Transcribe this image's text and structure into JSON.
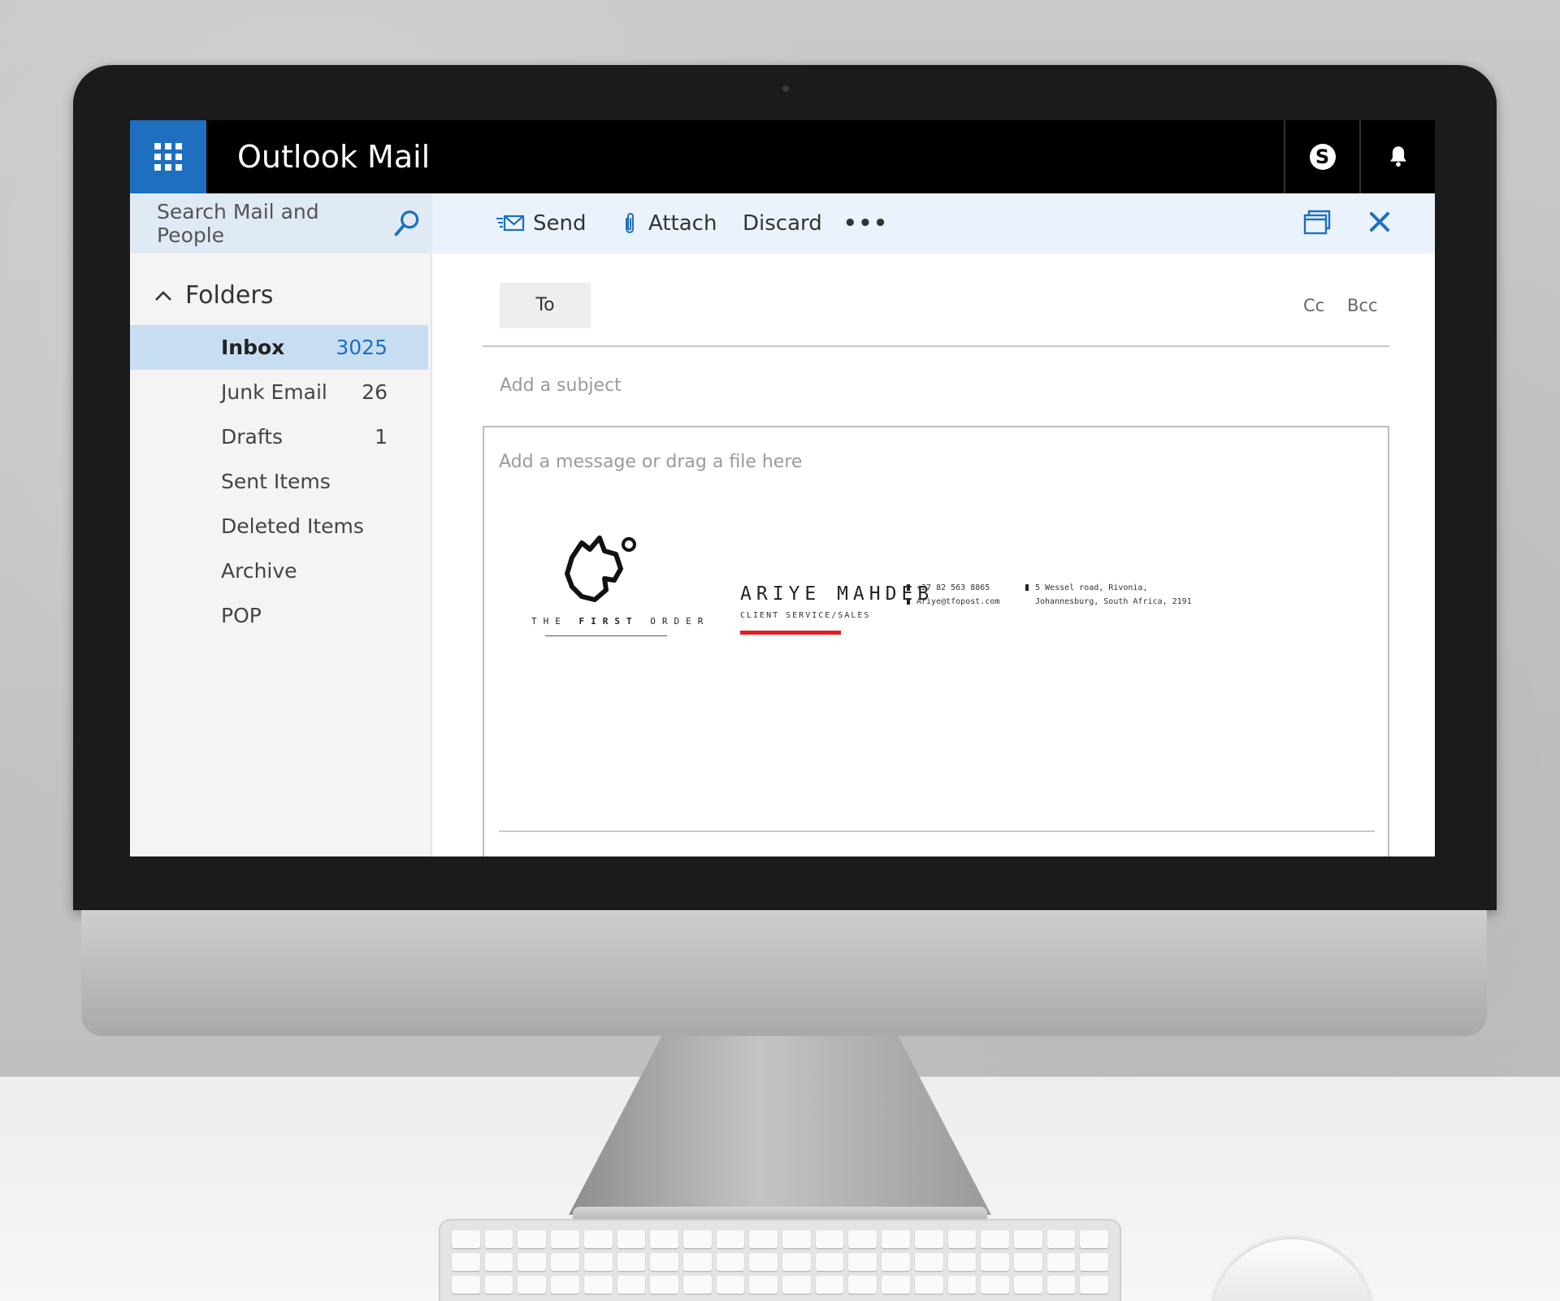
{
  "window": {
    "app_title": "Outlook Mail"
  },
  "topbar": {
    "launcher_icon": "app-launcher-icon",
    "skype_icon": "skype-icon",
    "bell_icon": "bell-icon",
    "accent_color": "#1e6fbf"
  },
  "search": {
    "placeholder": "Search Mail and People"
  },
  "toolbar": {
    "send_label": "Send",
    "attach_label": "Attach",
    "discard_label": "Discard",
    "more_label": "•••"
  },
  "nav": {
    "folders_label": "Folders",
    "folders": [
      {
        "name": "Inbox",
        "count": "3025",
        "selected": true
      },
      {
        "name": "Junk Email",
        "count": "26"
      },
      {
        "name": "Drafts",
        "count": "1"
      },
      {
        "name": "Sent Items",
        "count": ""
      },
      {
        "name": "Deleted Items",
        "count": ""
      },
      {
        "name": "Archive",
        "count": ""
      },
      {
        "name": "POP",
        "count": ""
      }
    ]
  },
  "compose": {
    "to_label": "To",
    "cc_label": "Cc",
    "bcc_label": "Bcc",
    "subject_placeholder": "Add a subject",
    "body_placeholder": "Add a message or drag a file here"
  },
  "signature": {
    "company_first": "THE ",
    "company_bold": "FIRST",
    "company_last": " ORDER",
    "name": "ARIYE MAHDEB",
    "role": "CLIENT SERVICE/SALES",
    "phone": "+27 82 563 8865",
    "email": "Ariye@tfopost.com",
    "address_line1": "5 Wessel road, Rivonia,",
    "address_line2": "Johannesburg, South Africa, 2191",
    "accent_color": "#e02020"
  }
}
